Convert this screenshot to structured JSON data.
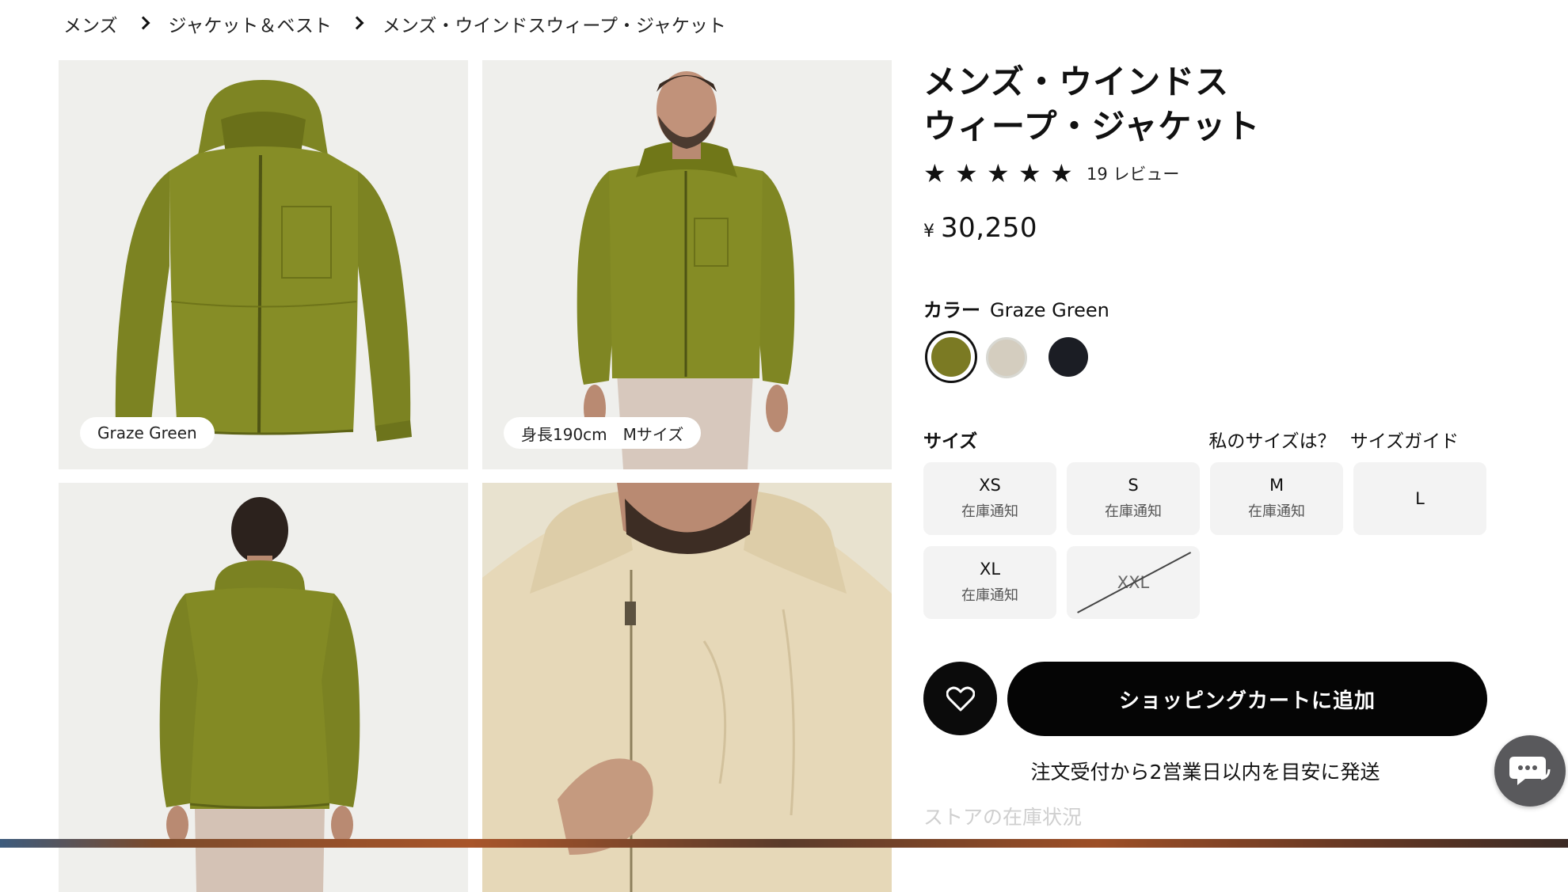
{
  "breadcrumb": {
    "items": [
      "メンズ",
      "ジャケット＆ベスト",
      "メンズ・ウインドスウィープ・ジャケット"
    ]
  },
  "gallery": {
    "captions": [
      "Graze Green",
      "身長190cm　Mサイズ"
    ]
  },
  "product": {
    "title_line1": "メンズ・ウインドス",
    "title_line2": "ウィープ・ジャケット",
    "rating": 5,
    "reviews_label": "19 レビュー",
    "currency": "¥",
    "price": "30,250"
  },
  "color": {
    "label": "カラー",
    "selected": "Graze Green",
    "swatches": [
      {
        "name": "Graze Green",
        "hex": "#7b7a23"
      },
      {
        "name": "beige",
        "hex": "#d4cdbf"
      },
      {
        "name": "black",
        "hex": "#1b1d24"
      }
    ]
  },
  "size": {
    "label": "サイズ",
    "my_size_link": "私のサイズは？",
    "guide_link": "サイズガイド",
    "options": [
      {
        "size": "XS",
        "note": "在庫通知"
      },
      {
        "size": "S",
        "note": "在庫通知"
      },
      {
        "size": "M",
        "note": "在庫通知"
      },
      {
        "size": "L",
        "note": ""
      },
      {
        "size": "XL",
        "note": "在庫通知"
      },
      {
        "size": "XXL",
        "note": "",
        "unavailable": true
      }
    ]
  },
  "actions": {
    "add_to_cart": "ショッピングカートに追加",
    "shipping_note": "注文受付から2営業日以内を目安に発送",
    "store_stock": "ストアの在庫状況"
  },
  "icons": {
    "favorite": "heart-icon",
    "chat": "chat-icon",
    "star": "star-icon",
    "chevron": "chevron-right-icon"
  },
  "colors": {
    "primary": "#050505",
    "muted_bg": "#f3f3f3",
    "accent_green": "#7b7a23"
  }
}
